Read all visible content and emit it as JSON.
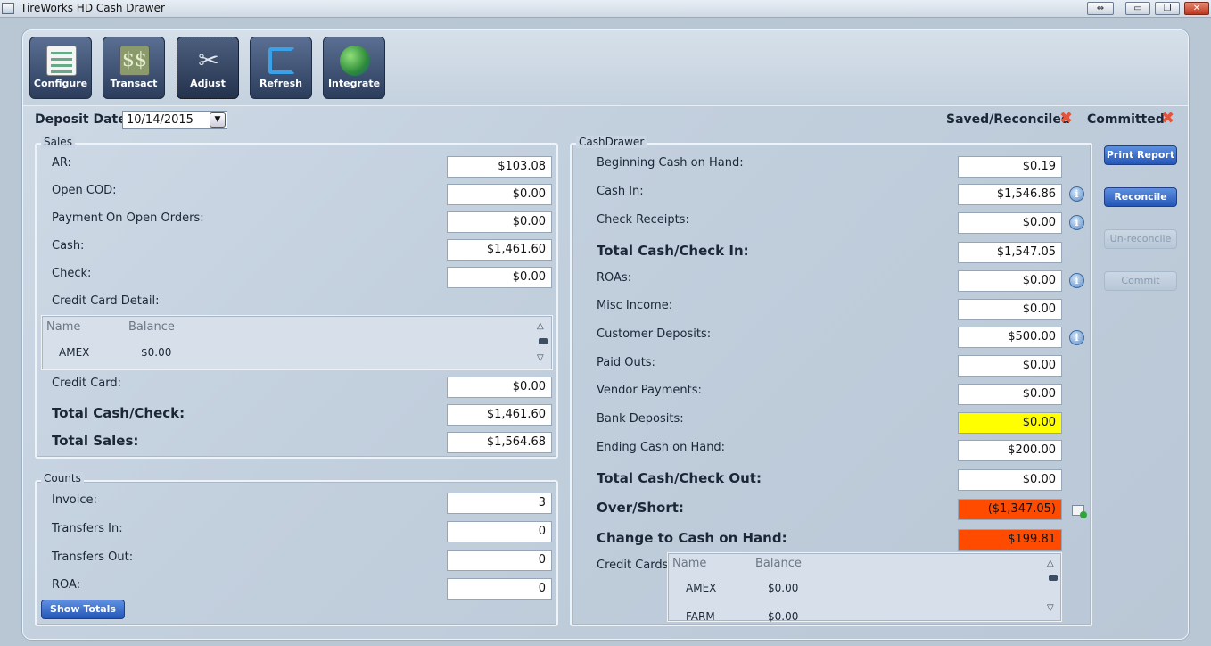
{
  "window": {
    "title": "TireWorks HD Cash Drawer",
    "buttons": [
      "restore-alt",
      "minimize",
      "maximize",
      "close"
    ]
  },
  "toolbar": {
    "items": [
      {
        "label": "Configure",
        "icon": "checklist-icon"
      },
      {
        "label": "Transact",
        "icon": "money-icon"
      },
      {
        "label": "Adjust",
        "icon": "tools-icon"
      },
      {
        "label": "Refresh",
        "icon": "refresh-icon"
      },
      {
        "label": "Integrate",
        "icon": "globe-icon"
      }
    ]
  },
  "deposit": {
    "label": "Deposit Date:",
    "value": "10/14/2015"
  },
  "status": {
    "saved_label": "Saved/Reconciled",
    "committed_label": "Committed"
  },
  "sales": {
    "title": "Sales",
    "rows": [
      {
        "label": "AR:",
        "value": "$103.08"
      },
      {
        "label": "Open COD:",
        "value": "$0.00"
      },
      {
        "label": "Payment On Open Orders:",
        "value": "$0.00"
      },
      {
        "label": "Cash:",
        "value": "$1,461.60"
      },
      {
        "label": "Check:",
        "value": "$0.00"
      }
    ],
    "cc_detail_label": "Credit Card Detail:",
    "cc_grid": {
      "headers": [
        "Name",
        "Balance"
      ],
      "rows": [
        {
          "name": "AMEX",
          "balance": "$0.00"
        }
      ]
    },
    "credit_card": {
      "label": "Credit Card:",
      "value": "$0.00"
    },
    "total_cash_check": {
      "label": "Total Cash/Check:",
      "value": "$1,461.60"
    },
    "total_sales": {
      "label": "Total Sales:",
      "value": "$1,564.68"
    }
  },
  "counts": {
    "title": "Counts",
    "rows": [
      {
        "label": "Invoice:",
        "value": "3"
      },
      {
        "label": "Transfers In:",
        "value": "0"
      },
      {
        "label": "Transfers Out:",
        "value": "0"
      },
      {
        "label": "ROA:",
        "value": "0"
      }
    ],
    "show_totals": "Show Totals"
  },
  "cashdrawer": {
    "title": "CashDrawer",
    "beginning": {
      "label": "Beginning Cash on Hand:",
      "value": "$0.19"
    },
    "cash_in": {
      "label": "Cash In:",
      "value": "$1,546.86"
    },
    "check_receipts": {
      "label": "Check Receipts:",
      "value": "$0.00"
    },
    "total_in": {
      "label": "Total Cash/Check In:",
      "value": "$1,547.05"
    },
    "roas": {
      "label": "ROAs:",
      "value": "$0.00"
    },
    "misc_income": {
      "label": "Misc Income:",
      "value": "$0.00"
    },
    "customer_deposits": {
      "label": "Customer Deposits:",
      "value": "$500.00"
    },
    "paid_outs": {
      "label": "Paid Outs:",
      "value": "$0.00"
    },
    "vendor_payments": {
      "label": "Vendor Payments:",
      "value": "$0.00"
    },
    "bank_deposits": {
      "label": "Bank Deposits:",
      "value": "$0.00"
    },
    "ending": {
      "label": "Ending Cash on Hand:",
      "value": "$200.00"
    },
    "total_out": {
      "label": "Total Cash/Check Out:",
      "value": "$0.00"
    },
    "over_short": {
      "label": "Over/Short:",
      "value": "($1,347.05)"
    },
    "change": {
      "label": "Change to Cash on Hand:",
      "value": "$199.81"
    },
    "credit_cards_label": "Credit Cards:",
    "cc_grid": {
      "headers": [
        "Name",
        "Balance"
      ],
      "rows": [
        {
          "name": "AMEX",
          "balance": "$0.00"
        },
        {
          "name": "FARM",
          "balance": "$0.00"
        }
      ]
    }
  },
  "actions": {
    "print_report": "Print Report",
    "reconcile": "Reconcile",
    "unreconcile": "Un-reconcile",
    "commit": "Commit"
  },
  "colors": {
    "highlight_yellow": "#ffff00",
    "alert_orange": "#ff4b00",
    "accent_blue": "#2456b8"
  }
}
